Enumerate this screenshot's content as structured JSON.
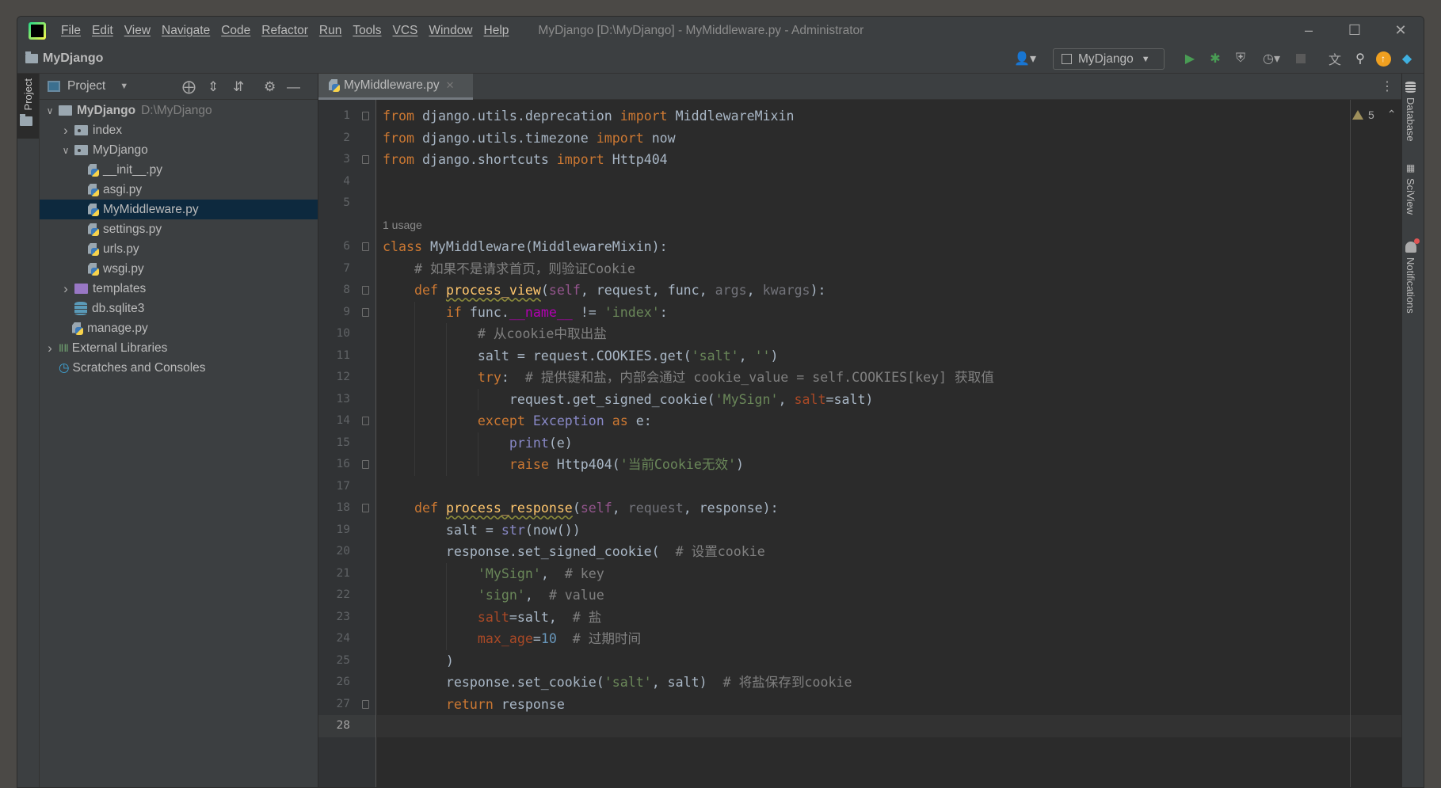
{
  "title_bar": {
    "menu": [
      "File",
      "Edit",
      "View",
      "Navigate",
      "Code",
      "Refactor",
      "Run",
      "Tools",
      "VCS",
      "Window",
      "Help"
    ],
    "window_title": "MyDjango [D:\\MyDjango] - MyMiddleware.py - Administrator"
  },
  "navbar": {
    "breadcrumb": "MyDjango",
    "run_config": "MyDjango",
    "accent_run": "#499c54"
  },
  "left_strip": {
    "project_tab": "Project"
  },
  "project": {
    "header": "Project",
    "tree": [
      {
        "label": "MyDjango",
        "extra": "D:\\MyDjango",
        "type": "root",
        "expanded": true
      },
      {
        "label": "index",
        "type": "package",
        "expanded": false
      },
      {
        "label": "MyDjango",
        "type": "package",
        "expanded": true
      },
      {
        "label": "__init__.py",
        "type": "py"
      },
      {
        "label": "asgi.py",
        "type": "py"
      },
      {
        "label": "MyMiddleware.py",
        "type": "py",
        "selected": true
      },
      {
        "label": "settings.py",
        "type": "py"
      },
      {
        "label": "urls.py",
        "type": "py"
      },
      {
        "label": "wsgi.py",
        "type": "py"
      },
      {
        "label": "templates",
        "type": "templates",
        "expanded": false
      },
      {
        "label": "db.sqlite3",
        "type": "db"
      },
      {
        "label": "manage.py",
        "type": "py"
      },
      {
        "label": "External Libraries",
        "type": "libs",
        "expanded": false
      },
      {
        "label": "Scratches and Consoles",
        "type": "scratch"
      }
    ]
  },
  "editor": {
    "tab": "MyMiddleware.py",
    "warnings": "5",
    "usage_hint": "1 usage",
    "current_line": 28,
    "lines": [
      [
        [
          "from",
          "kw"
        ],
        [
          " django.utils.deprecation ",
          ""
        ],
        [
          "import",
          "kw"
        ],
        [
          " MiddlewareMixin",
          ""
        ]
      ],
      [
        [
          "from",
          "kw"
        ],
        [
          " django.utils.timezone ",
          ""
        ],
        [
          "import",
          "kw"
        ],
        [
          " now",
          ""
        ]
      ],
      [
        [
          "from",
          "kw"
        ],
        [
          " django.shortcuts ",
          ""
        ],
        [
          "import",
          "kw"
        ],
        [
          " Http404",
          ""
        ]
      ],
      [],
      [],
      [
        [
          "class",
          "kw"
        ],
        [
          " MyMiddleware(MiddlewareMixin):",
          ""
        ]
      ],
      [
        [
          "    ",
          ""
        ],
        [
          "# 如果不是请求首页，则验证Cookie",
          "cm"
        ]
      ],
      [
        [
          "    ",
          ""
        ],
        [
          "def",
          "kw"
        ],
        [
          " ",
          ""
        ],
        [
          "process_view",
          "fn"
        ],
        [
          "(",
          ""
        ],
        [
          "self",
          "self"
        ],
        [
          ", request, func, ",
          ""
        ],
        [
          "args",
          "unused"
        ],
        [
          ", ",
          ""
        ],
        [
          "kwargs",
          "unused"
        ],
        [
          "):",
          ""
        ]
      ],
      [
        [
          "        ",
          ""
        ],
        [
          "if",
          "kw"
        ],
        [
          " func.",
          ""
        ],
        [
          "__name__",
          "magic"
        ],
        [
          " != ",
          ""
        ],
        [
          "'index'",
          "str"
        ],
        [
          ":",
          ""
        ]
      ],
      [
        [
          "            ",
          ""
        ],
        [
          "# 从cookie中取出盐",
          "cm"
        ]
      ],
      [
        [
          "            salt = request.COOKIES.get(",
          ""
        ],
        [
          "'salt'",
          "str"
        ],
        [
          ", ",
          ""
        ],
        [
          "''",
          "str"
        ],
        [
          ")",
          ""
        ]
      ],
      [
        [
          "            ",
          ""
        ],
        [
          "try",
          "kw"
        ],
        [
          ":  ",
          ""
        ],
        [
          "# 提供键和盐，内部会通过 cookie_value = self.COOKIES[key] 获取值",
          "cm"
        ]
      ],
      [
        [
          "                request.get_signed_cookie(",
          ""
        ],
        [
          "'MySign'",
          "str"
        ],
        [
          ", ",
          ""
        ],
        [
          "salt",
          "kwarg"
        ],
        [
          "=salt)",
          ""
        ]
      ],
      [
        [
          "            ",
          ""
        ],
        [
          "except",
          "kw"
        ],
        [
          " ",
          ""
        ],
        [
          "Exception",
          "bi"
        ],
        [
          " ",
          ""
        ],
        [
          "as",
          "kw"
        ],
        [
          " e:",
          ""
        ]
      ],
      [
        [
          "                ",
          ""
        ],
        [
          "print",
          "bi"
        ],
        [
          "(e)",
          ""
        ]
      ],
      [
        [
          "                ",
          ""
        ],
        [
          "raise",
          "kw"
        ],
        [
          " Http404(",
          ""
        ],
        [
          "'当前Cookie无效'",
          "str"
        ],
        [
          ")",
          ""
        ]
      ],
      [],
      [
        [
          "    ",
          ""
        ],
        [
          "def",
          "kw"
        ],
        [
          " ",
          ""
        ],
        [
          "process_response",
          "fn"
        ],
        [
          "(",
          ""
        ],
        [
          "self",
          "self"
        ],
        [
          ", ",
          ""
        ],
        [
          "request",
          "unused"
        ],
        [
          ", response):",
          ""
        ]
      ],
      [
        [
          "        salt = ",
          ""
        ],
        [
          "str",
          "bi"
        ],
        [
          "(now())",
          ""
        ]
      ],
      [
        [
          "        response.set_signed_cookie(  ",
          ""
        ],
        [
          "# 设置cookie",
          "cm"
        ]
      ],
      [
        [
          "            ",
          ""
        ],
        [
          "'MySign'",
          "str"
        ],
        [
          ",  ",
          ""
        ],
        [
          "# key",
          "cm"
        ]
      ],
      [
        [
          "            ",
          ""
        ],
        [
          "'sign'",
          "str"
        ],
        [
          ",  ",
          ""
        ],
        [
          "# value",
          "cm"
        ]
      ],
      [
        [
          "            ",
          ""
        ],
        [
          "salt",
          "kwarg"
        ],
        [
          "=salt,  ",
          ""
        ],
        [
          "# 盐",
          "cm"
        ]
      ],
      [
        [
          "            ",
          ""
        ],
        [
          "max_age",
          "kwarg"
        ],
        [
          "=",
          ""
        ],
        [
          "10",
          "num"
        ],
        [
          "  ",
          ""
        ],
        [
          "# 过期时间",
          "cm"
        ]
      ],
      [
        [
          "        )",
          ""
        ]
      ],
      [
        [
          "        response.set_cookie(",
          ""
        ],
        [
          "'salt'",
          "str"
        ],
        [
          ", salt)  ",
          ""
        ],
        [
          "# 将盐保存到cookie",
          "cm"
        ]
      ],
      [
        [
          "        ",
          ""
        ],
        [
          "return",
          "kw"
        ],
        [
          " response",
          ""
        ]
      ],
      []
    ],
    "fold_lines": [
      1,
      3,
      6,
      8,
      9,
      14,
      16,
      18,
      27
    ]
  },
  "right_strip": {
    "tabs": [
      "Database",
      "SciView",
      "Notifications"
    ]
  }
}
